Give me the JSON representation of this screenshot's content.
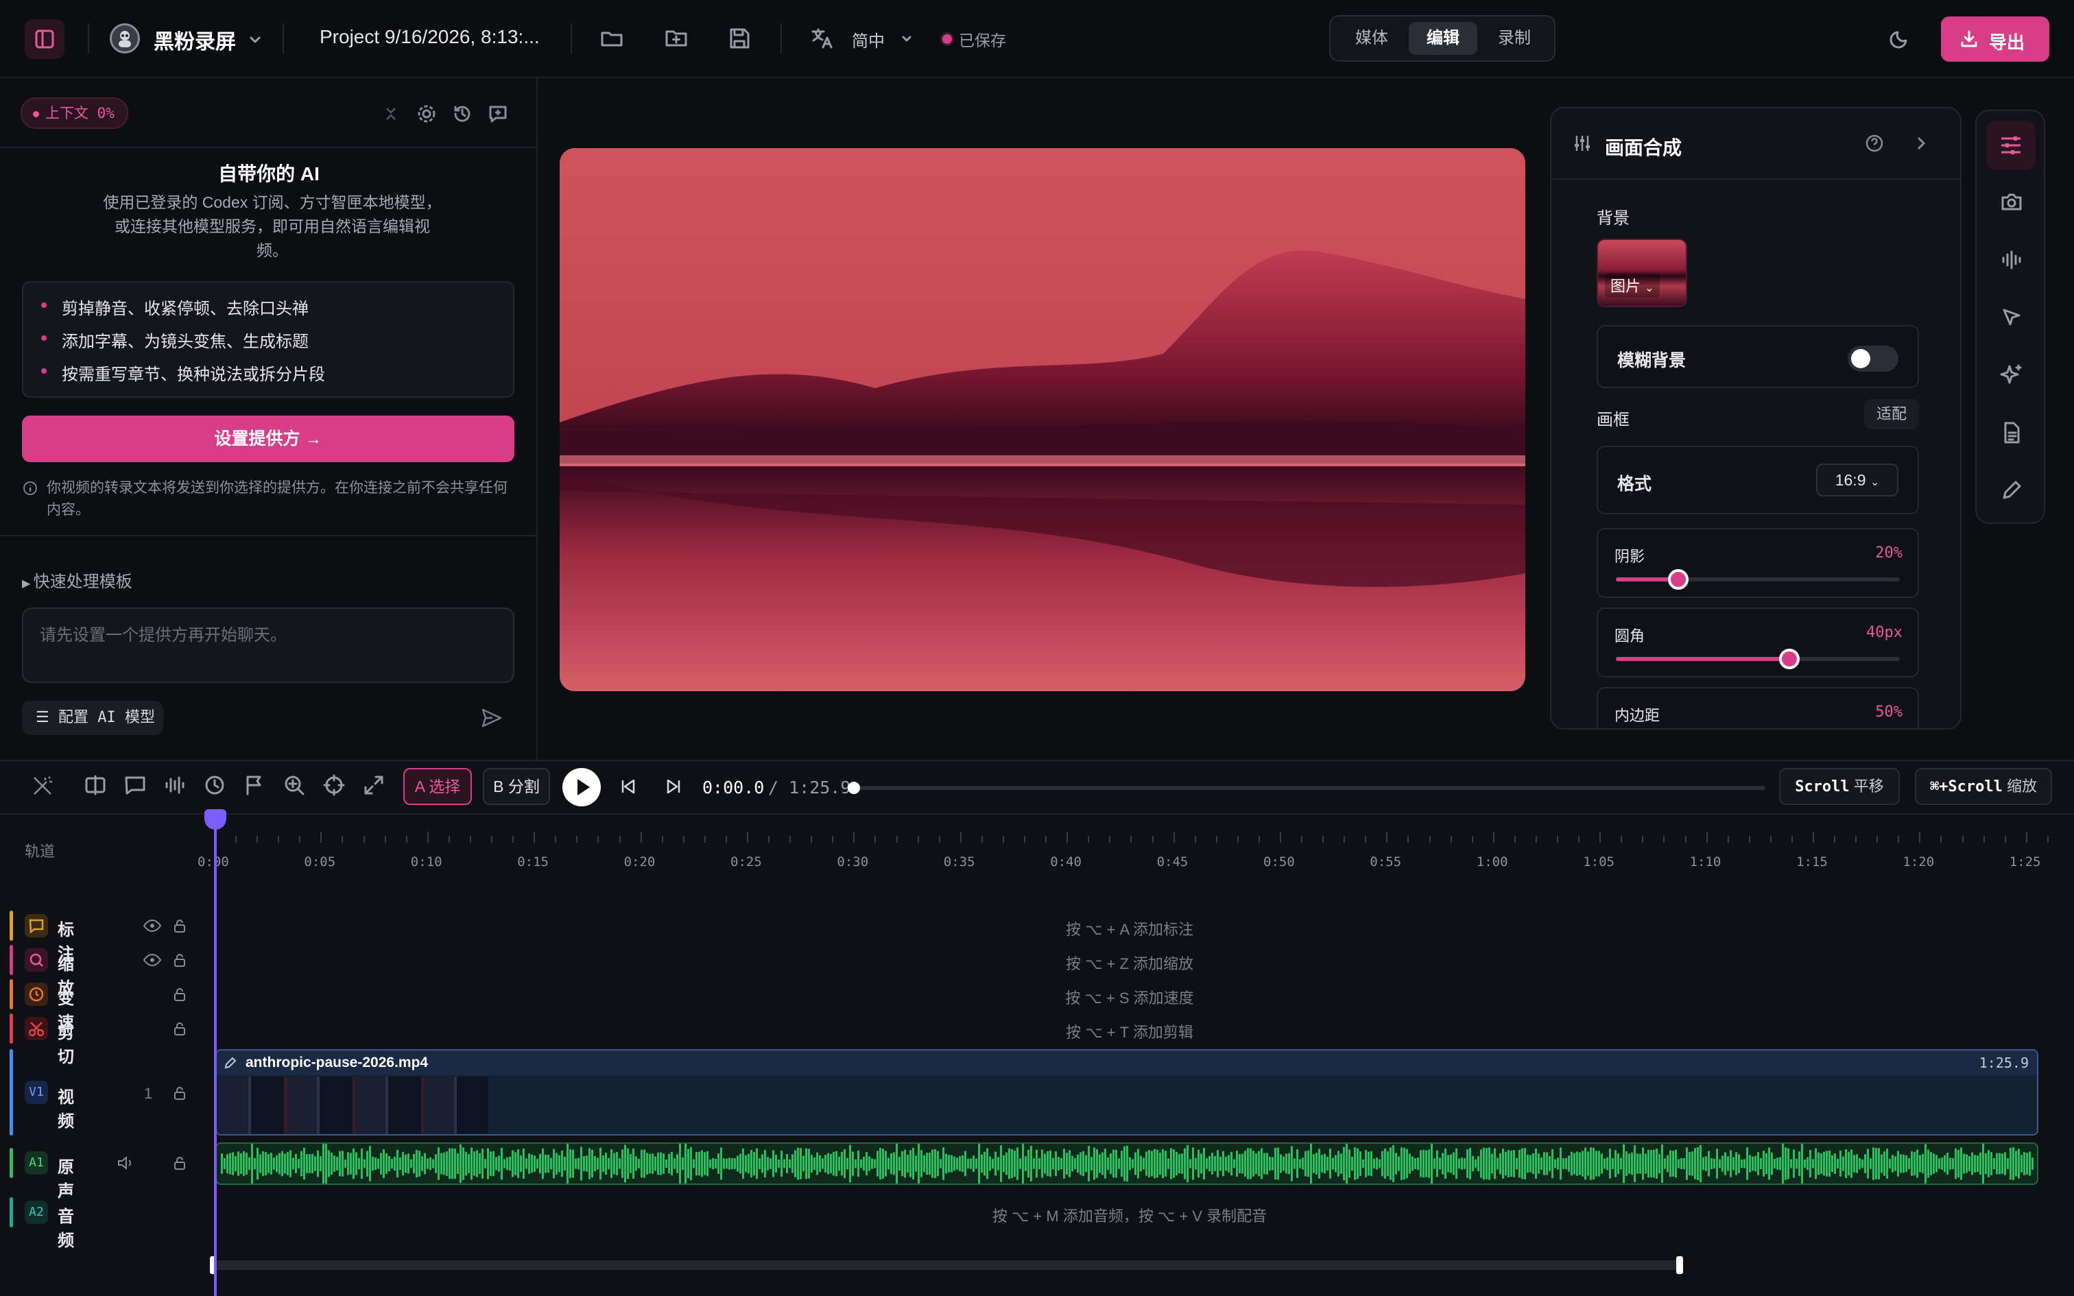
{
  "app": {
    "name": "黑粉录屏",
    "project": "Project 9/16/2026, 8:13:...",
    "language": "简中",
    "saved": "已保存",
    "modes": [
      "媒体",
      "编辑",
      "录制"
    ],
    "active_mode": "编辑",
    "export": "导出"
  },
  "colors": {
    "accent": "#d83d88",
    "bg": "#0d0e12",
    "audio_wave": "#27c160",
    "playhead": "#7b5cff"
  },
  "left": {
    "context_badge": "上下文 0%",
    "title": "自带你的 AI",
    "desc": "使用已登录的 Codex 订阅、方寸智匣本地模型，或连接其他模型服务，即可用自然语言编辑视频。",
    "features": [
      "剪掉静音、收紧停顿、去除口头禅",
      "添加字幕、为镜头变焦、生成标题",
      "按需重写章节、换种说法或拆分片段"
    ],
    "setup_button": "设置提供方",
    "notice": "你视频的转录文本将发送到你选择的提供方。在你连接之前不会共享任何内容。",
    "templates": "快速处理模板",
    "chat_placeholder": "请先设置一个提供方再开始聊天。",
    "config_model": "配置 AI 模型"
  },
  "compose": {
    "title": "画面合成",
    "background_label": "背景",
    "background_type": "图片",
    "blur_label": "模糊背景",
    "blur_on": false,
    "frame_label": "画框",
    "fit": "适配",
    "format_label": "格式",
    "format_value": "16:9",
    "shadow_label": "阴影",
    "shadow_value": "20%",
    "shadow_fraction": 0.22,
    "radius_label": "圆角",
    "radius_value": "40px",
    "radius_fraction": 0.61,
    "padding_label": "内边距",
    "padding_value": "50%",
    "padding_fraction": 0.5
  },
  "timeline": {
    "select": "A 选择",
    "split": "B 分割",
    "current_time": "0:00.0",
    "duration": "/ 1:25.9",
    "scroll_pan": "Scroll",
    "pan_label": "平移",
    "scroll_zoom": "⌘+Scroll",
    "zoom_label": "缩放",
    "tracks_header": "轨道",
    "ticks": [
      "0:00",
      "0:05",
      "0:10",
      "0:15",
      "0:20",
      "0:25",
      "0:30",
      "0:35",
      "0:40",
      "0:45",
      "0:50",
      "0:55",
      "1:00",
      "1:05",
      "1:10",
      "1:15",
      "1:20",
      "1:25"
    ],
    "tracks": [
      {
        "name": "标注",
        "hint": "按 ⌥ + A 添加标注",
        "color": "#e0a320"
      },
      {
        "name": "缩放",
        "hint": "按 ⌥ + Z 添加缩放",
        "color": "#d83d88"
      },
      {
        "name": "变速",
        "hint": "按 ⌥ + S 添加速度",
        "color": "#e8772e"
      },
      {
        "name": "剪切",
        "hint": "按 ⌥ + T 添加剪辑",
        "color": "#e0404a"
      }
    ],
    "video_track": {
      "tag": "V1",
      "name": "视频",
      "count": "1",
      "clip": "anthropic-pause-2026.mp4",
      "clip_duration": "1:25.9"
    },
    "audio_track": {
      "tag": "A1",
      "name": "原声"
    },
    "music_track": {
      "tag": "A2",
      "name": "音频",
      "hint": "按 ⌥ + M 添加音频，按 ⌥ + V 录制配音"
    }
  }
}
